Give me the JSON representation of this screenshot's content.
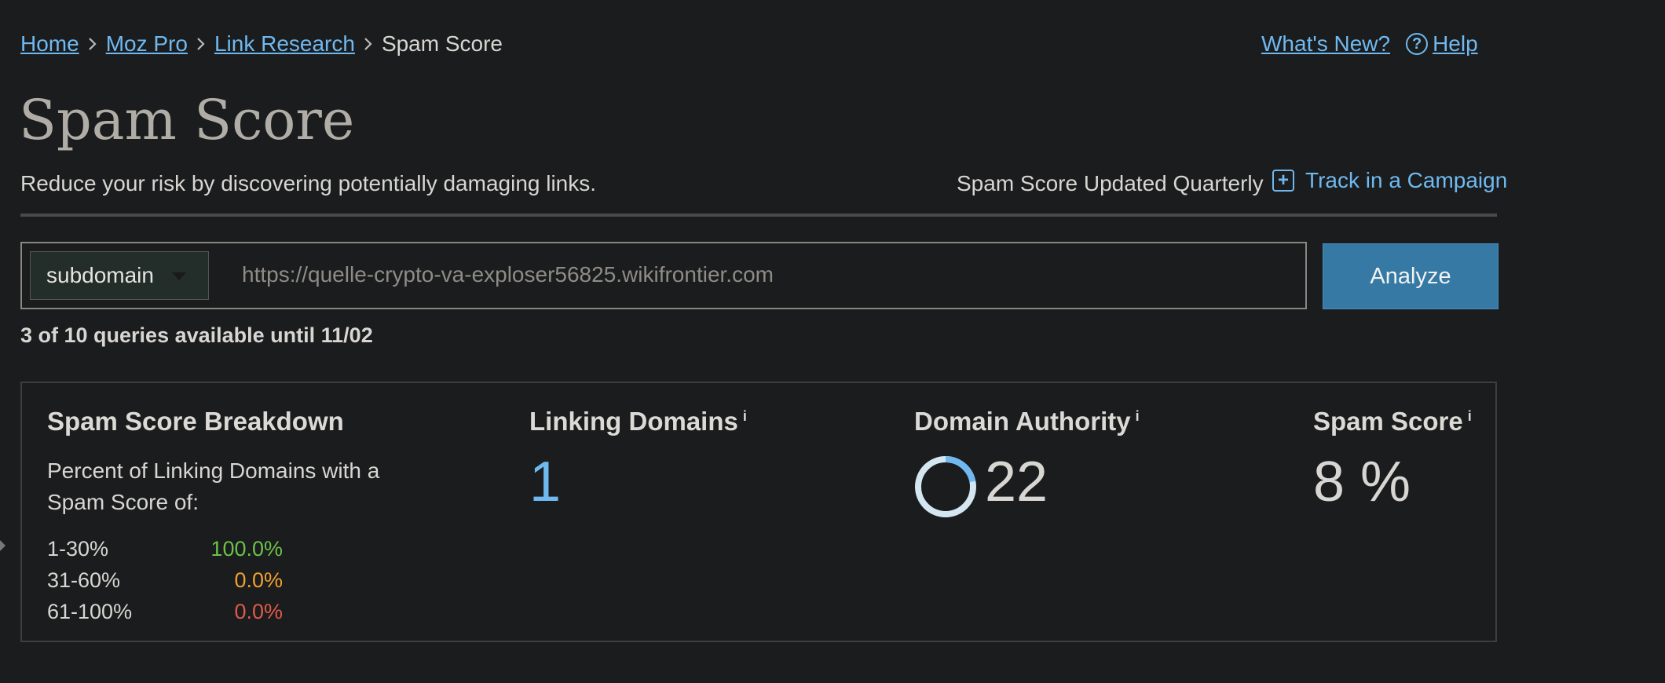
{
  "breadcrumb": {
    "items": [
      "Home",
      "Moz Pro",
      "Link Research"
    ],
    "current": "Spam Score"
  },
  "header_links": {
    "whats_new": "What's New?",
    "help_icon_glyph": "?",
    "help": "Help"
  },
  "page": {
    "title": "Spam Score",
    "subtitle": "Reduce your risk by discovering potentially damaging links.",
    "update_note": "Spam Score Updated Quarterly",
    "track_icon_glyph": "+",
    "track_label": "Track in a Campaign"
  },
  "search": {
    "scope": "subdomain",
    "url": "https://quelle-crypto-va-exploser56825.wikifrontier.com",
    "analyze_label": "Analyze",
    "quota": "3 of 10 queries available until 11/02"
  },
  "breakdown": {
    "title": "Spam Score Breakdown",
    "description": "Percent of Linking Domains with a Spam Score of:",
    "rows": [
      {
        "range": "1-30%",
        "percent": "100.0%",
        "color": "#6bc24a"
      },
      {
        "range": "31-60%",
        "percent": "0.0%",
        "color": "#f0a030"
      },
      {
        "range": "61-100%",
        "percent": "0.0%",
        "color": "#e05a48"
      }
    ]
  },
  "metrics": {
    "info_glyph": "i",
    "linking_domains": {
      "label": "Linking Domains",
      "value": "1",
      "color": "#6fb9f0"
    },
    "domain_authority": {
      "label": "Domain Authority",
      "value": "22",
      "fraction": 0.22
    },
    "spam_score": {
      "label": "Spam Score",
      "value": "8 %"
    }
  },
  "colors": {
    "link": "#6fb9f0",
    "button": "#3579a4",
    "ring_track": "#d4e6f0",
    "ring_fill": "#6fb9f0"
  }
}
